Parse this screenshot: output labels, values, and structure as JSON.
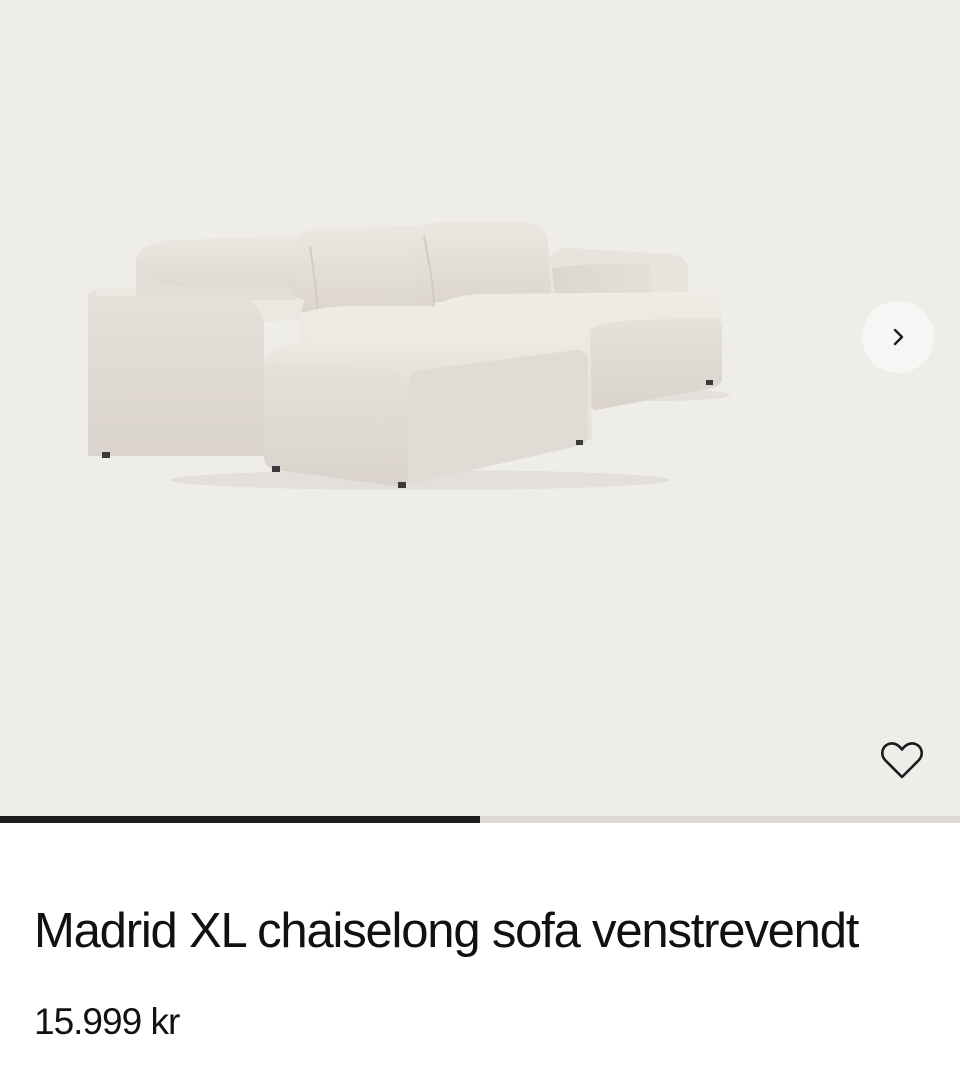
{
  "gallery": {
    "image_name": "sofa-product-image",
    "progress_fraction": 0.5,
    "next_icon": "chevron-right-icon",
    "wishlist_icon": "heart-outline-icon"
  },
  "product": {
    "title": "Madrid XL chaiselong sofa venstrevendt",
    "price": "15.999 kr"
  },
  "colors": {
    "gallery_background": "#efedea",
    "fabric": "#e2ddd6",
    "progress_active": "#1c1c1c",
    "progress_inactive": "#dcd9d5",
    "text": "#111111"
  }
}
